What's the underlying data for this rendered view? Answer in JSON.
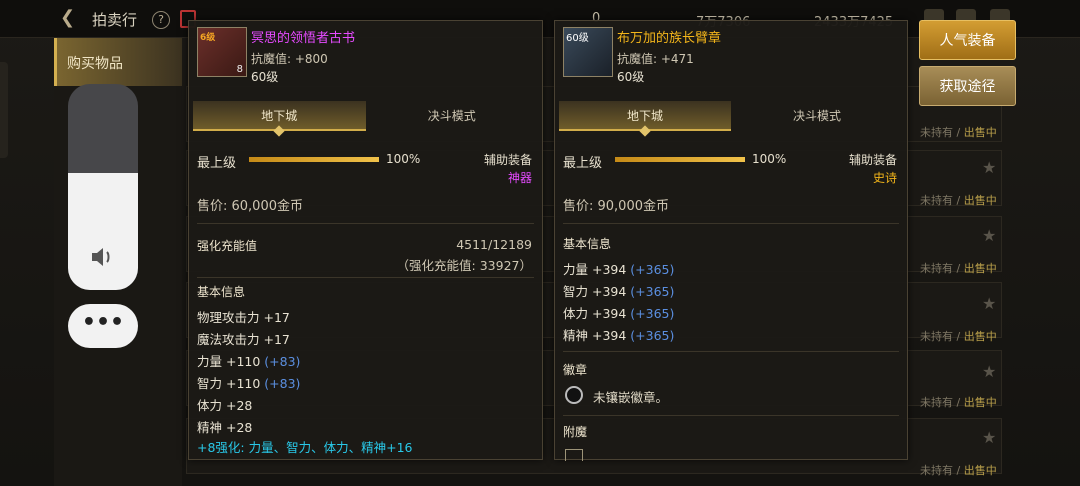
{
  "topbar": {
    "title": "拍卖行",
    "help": "?",
    "gold_left": "0",
    "coins": "7万7306",
    "gold_total": "2433万7425"
  },
  "sidebar": {
    "active_tab": "购买物品"
  },
  "overlay": {
    "volume_level": 0.57,
    "more": "•••"
  },
  "list": {
    "status_not_owned": "未持有",
    "status_sep": " / ",
    "status_selling": "出售中"
  },
  "item1": {
    "name": "冥思的领悟者古书",
    "name_color": "#e64bff",
    "icon_tag": "6级",
    "icon_num": "8",
    "resist": "抗魔值: +800",
    "level": "60级",
    "tab_dungeon": "地下城",
    "tab_duel": "决斗模式",
    "grade_label": "最上级",
    "grade_pct": "100%",
    "grade_value": 1.0,
    "slot_type": "辅助装备",
    "rarity": "神器",
    "rarity_color": "#e64bff",
    "price": "售价: 60,000金币",
    "charge_title": "强化充能值",
    "charge_val": "4511/12189",
    "charge_sub": "（强化充能值: 33927）",
    "basic_title": "基本信息",
    "stats": [
      {
        "name": "物理攻击力 +17",
        "bonus": ""
      },
      {
        "name": "魔法攻击力 +17",
        "bonus": ""
      },
      {
        "name": "力量 +110 ",
        "bonus": "(+83)"
      },
      {
        "name": "智力 +110 ",
        "bonus": "(+83)"
      },
      {
        "name": "体力 +28",
        "bonus": ""
      },
      {
        "name": "精神 +28",
        "bonus": ""
      }
    ],
    "enhance": "+8强化: 力量、智力、体力、精神+16"
  },
  "item2": {
    "name": "布万加的族长臂章",
    "name_color": "#f3b51a",
    "icon_lv": "60级",
    "resist": "抗魔值: +471",
    "level": "60级",
    "tab_dungeon": "地下城",
    "tab_duel": "决斗模式",
    "grade_label": "最上级",
    "grade_pct": "100%",
    "grade_value": 1.0,
    "slot_type": "辅助装备",
    "rarity": "史诗",
    "rarity_color": "#f3b51a",
    "price": "售价: 90,000金币",
    "basic_title": "基本信息",
    "stats": [
      {
        "name": "力量 +394 ",
        "bonus": "(+365)"
      },
      {
        "name": "智力 +394 ",
        "bonus": "(+365)"
      },
      {
        "name": "体力 +394 ",
        "bonus": "(+365)"
      },
      {
        "name": "精神 +394 ",
        "bonus": "(+365)"
      }
    ],
    "emblem_title": "徽章",
    "emblem_text": "未镶嵌徽章。",
    "enchant_title": "附魔"
  },
  "buttons": {
    "popular": "人气装备",
    "obtain": "获取途径"
  }
}
